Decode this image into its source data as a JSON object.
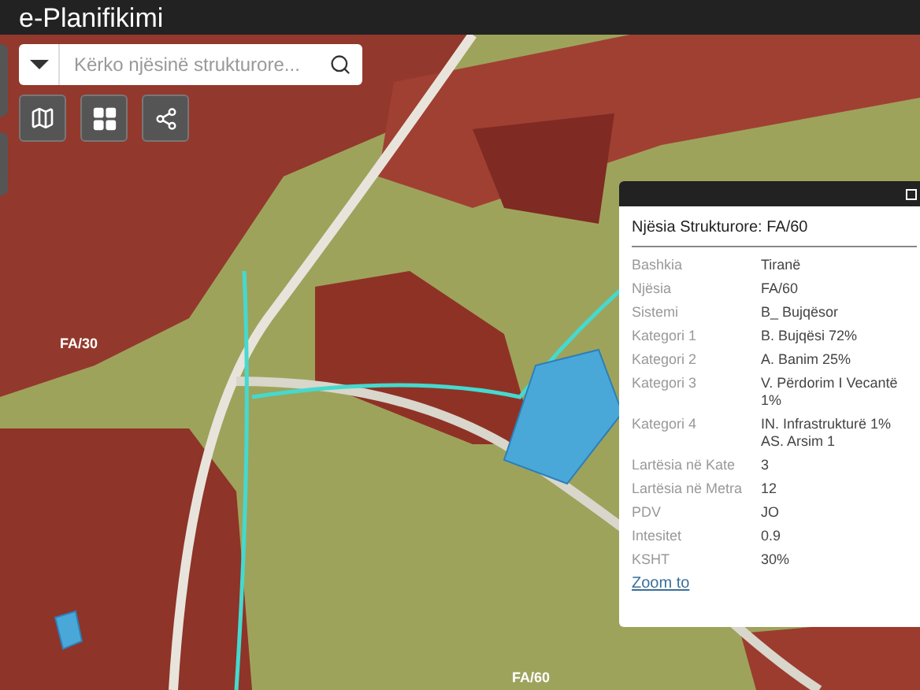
{
  "header": {
    "title": "e-Planifikimi"
  },
  "search": {
    "placeholder": "Kërko njësinë strukturore..."
  },
  "map": {
    "labels": [
      "FA/30",
      "FA/60"
    ]
  },
  "popup": {
    "title": "Njësia Strukturore: FA/60",
    "rows": [
      {
        "label": "Bashkia",
        "value": [
          "Tiranë"
        ]
      },
      {
        "label": "Njësia",
        "value": [
          "FA/60"
        ]
      },
      {
        "label": "Sistemi",
        "value": [
          "B_ Bujqësor"
        ]
      },
      {
        "label": "Kategori 1",
        "value": [
          "B. Bujqësi 72%"
        ]
      },
      {
        "label": "Kategori 2",
        "value": [
          "A. Banim 25%"
        ]
      },
      {
        "label": "Kategori 3",
        "value": [
          "V. Përdorim I Vecantë 1%"
        ]
      },
      {
        "label": "Kategori 4",
        "value": [
          "IN. Infrastrukturë 1%",
          "AS. Arsim 1"
        ]
      },
      {
        "label": "Lartësia në Kate",
        "value": [
          "3"
        ]
      },
      {
        "label": "Lartësia në Metra",
        "value": [
          "12"
        ]
      },
      {
        "label": "PDV",
        "value": [
          "JO"
        ]
      },
      {
        "label": "Intesitet",
        "value": [
          "0.9"
        ]
      },
      {
        "label": "KSHT",
        "value": [
          "30%"
        ]
      }
    ],
    "link": "Zoom to"
  }
}
